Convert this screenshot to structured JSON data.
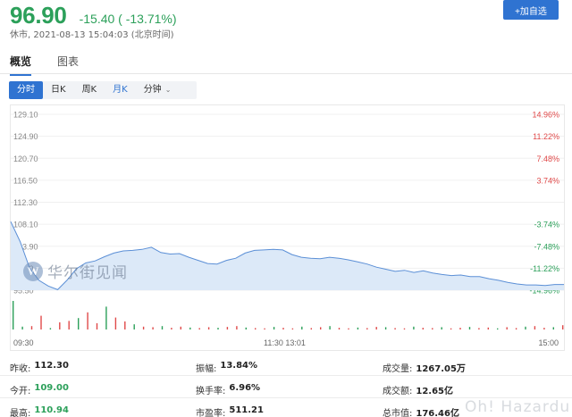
{
  "quote": {
    "price": "96.90",
    "change": "-15.40 ( -13.71%)",
    "status": "休市, 2021-08-13 15:04:03 (北京时间)"
  },
  "actions": {
    "add_watchlist": "+加自选"
  },
  "tabs": [
    {
      "label": "概览",
      "active": true
    },
    {
      "label": "图表",
      "active": false
    }
  ],
  "periods": [
    {
      "label": "分时",
      "active": true
    },
    {
      "label": "日K"
    },
    {
      "label": "周K"
    },
    {
      "label": "月K"
    },
    {
      "label": "分钟",
      "dropdown": true
    }
  ],
  "watermark": {
    "text": "华尔街见闻"
  },
  "chart_data": {
    "type": "area",
    "y_left_ticks": [
      "129.10",
      "124.90",
      "120.70",
      "116.50",
      "112.30",
      "108.10",
      "103.90",
      "99.70",
      "95.50"
    ],
    "y_right_ticks": [
      "14.96%",
      "11.22%",
      "7.48%",
      "3.74%",
      "",
      "-3.74%",
      "-7.48%",
      "-11.22%",
      "-14.96%"
    ],
    "x_ticks": [
      "09:30",
      "11:30 13:01",
      "15:00"
    ],
    "ylim": [
      95.5,
      129.1
    ],
    "prev_close": 112.3,
    "price_series": [
      108.6,
      104.8,
      99.8,
      97.4,
      96.3,
      95.6,
      97.4,
      99.6,
      100.7,
      101.1,
      101.9,
      102.6,
      103.0,
      103.1,
      103.3,
      103.7,
      102.7,
      102.4,
      102.5,
      101.8,
      101.2,
      100.6,
      100.5,
      101.2,
      101.6,
      102.6,
      103.1,
      103.2,
      103.3,
      103.2,
      102.3,
      101.8,
      101.6,
      101.5,
      101.8,
      101.6,
      101.3,
      100.9,
      100.5,
      99.9,
      99.5,
      99.1,
      99.3,
      98.9,
      99.2,
      98.8,
      98.5,
      98.3,
      98.4,
      98.1,
      98.1,
      97.7,
      97.4,
      97.0,
      96.7,
      96.5,
      96.5,
      96.4,
      96.6,
      96.6
    ],
    "volume_series": [
      100,
      10,
      12,
      48,
      5,
      25,
      30,
      40,
      60,
      22,
      80,
      42,
      28,
      18,
      10,
      8,
      12,
      6,
      10,
      7,
      5,
      8,
      6,
      9,
      12,
      7,
      5,
      4,
      9,
      6,
      4,
      10,
      5,
      8,
      12,
      6,
      4,
      7,
      5,
      9,
      8,
      5,
      4,
      10,
      6,
      5,
      8,
      4,
      6,
      9,
      5,
      7,
      4,
      8,
      5,
      10,
      12,
      6,
      8,
      15
    ]
  },
  "stats": [
    [
      {
        "label": "昨收:",
        "value": "112.30"
      },
      {
        "label": "振幅:",
        "value": "13.84%"
      },
      {
        "label": "成交量:",
        "value": "1267.05万"
      }
    ],
    [
      {
        "label": "今开:",
        "value": "109.00",
        "green": true
      },
      {
        "label": "换手率:",
        "value": "6.96%"
      },
      {
        "label": "成交额:",
        "value": "12.65亿"
      }
    ],
    [
      {
        "label": "最高:",
        "value": "110.94",
        "green": true
      },
      {
        "label": "市盈率:",
        "value": "511.21"
      },
      {
        "label": "总市值:",
        "value": "176.46亿"
      }
    ]
  ],
  "corner_watermark": "Oh! Hazardu",
  "colors": {
    "green": "#2ca05a",
    "red": "#e04a4a",
    "accent": "#2f73d1",
    "line": "#5b8fd6",
    "area": "#dce9f8"
  }
}
